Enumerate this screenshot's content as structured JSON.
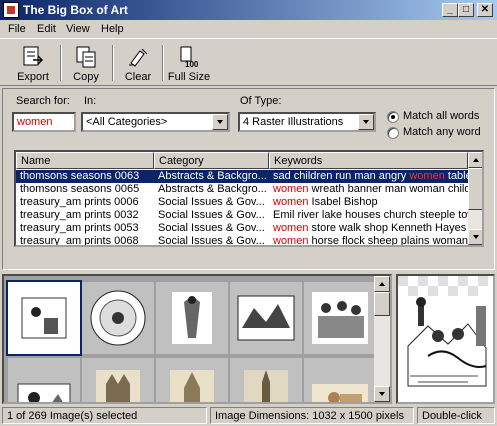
{
  "window": {
    "title": "The Big Box of Art",
    "minimize_glyph": "_",
    "maximize_glyph": "□",
    "close_glyph": "✕"
  },
  "menu": {
    "file": "File",
    "edit": "Edit",
    "view": "View",
    "help": "Help"
  },
  "toolbar": {
    "export": "Export",
    "copy": "Copy",
    "clear": "Clear",
    "full_size": "Full Size",
    "full_size_badge": "100"
  },
  "search": {
    "search_for_label": "Search for:",
    "search_for_value": "women",
    "in_label": "In:",
    "in_value": "<All Categories>",
    "of_type_label": "Of Type:",
    "of_type_value": "4 Raster Illustrations",
    "match_all": "Match all words",
    "match_any": "Match any word",
    "match_all_selected": true
  },
  "list": {
    "columns": [
      "Name",
      "Category",
      "Keywords"
    ],
    "rows": [
      {
        "name": "thomsons seasons 0063",
        "category": "Abstracts & Backgro...",
        "kw_pre": "sad children run man angry ",
        "kw_hl": "women",
        "kw_post": " tables",
        "selected": true
      },
      {
        "name": "thomsons seasons 0065",
        "category": "Abstracts & Backgro...",
        "kw_pre": "",
        "kw_hl": "women",
        "kw_post": " wreath banner man woman child",
        "selected": false
      },
      {
        "name": "treasury_am prints 0006",
        "category": "Social Issues & Gov...",
        "kw_pre": "",
        "kw_hl": "women",
        "kw_post": " Isabel Bishop",
        "selected": false
      },
      {
        "name": "treasury_am prints 0032",
        "category": "Social Issues & Gov...",
        "kw_pre": "Emil river lake houses church steeple tow",
        "kw_hl": "",
        "kw_post": "",
        "selected": false
      },
      {
        "name": "treasury_am prints 0053",
        "category": "Social Issues & Gov...",
        "kw_pre": "",
        "kw_hl": "women",
        "kw_post": " store walk shop Kenneth Hayes M",
        "selected": false
      },
      {
        "name": "treasury_am prints 0068",
        "category": "Social Issues & Gov...",
        "kw_pre": "",
        "kw_hl": "women",
        "kw_post": " horse flock sheep plains woman",
        "selected": false
      }
    ]
  },
  "thumbnails": {
    "items": [
      "t1",
      "t2",
      "t3",
      "t4",
      "t5",
      "t6",
      "t7",
      "t8",
      "t9",
      "t10"
    ]
  },
  "status": {
    "selection": "1 of 269 Image(s) selected",
    "dimensions": "Image Dimensions: 1032 x 1500 pixels",
    "hint": "Double-click"
  },
  "colors": {
    "title_gradient_start": "#0a246a",
    "selection": "#0a246a",
    "highlight": "#d40000",
    "face": "#d4d0c8"
  }
}
